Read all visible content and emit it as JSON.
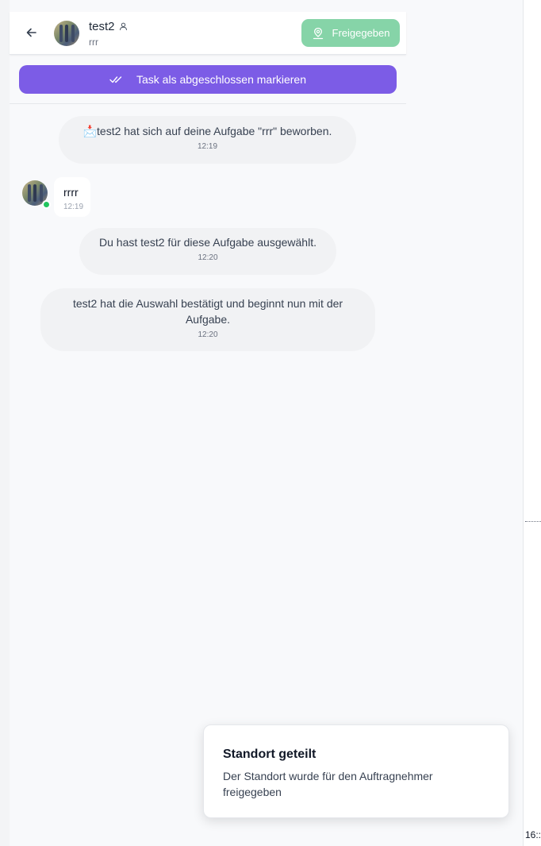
{
  "header": {
    "contact_name": "test2",
    "subtitle": "rrr",
    "share_button_label": "Freigegeben"
  },
  "action": {
    "complete_task_label": "Task als abgeschlossen markieren"
  },
  "messages": [
    {
      "type": "system",
      "emoji": "📩",
      "text": "test2 hat sich auf deine Aufgabe \"rrr\" beworben.",
      "time": "12:19"
    },
    {
      "type": "user",
      "sender": "test2",
      "text": "rrrr",
      "time": "12:19"
    },
    {
      "type": "system",
      "text": "Du hast test2 für diese Aufgabe ausgewählt.",
      "time": "12:20"
    },
    {
      "type": "system",
      "text": "test2 hat die Auswahl bestätigt und beginnt nun mit der Aufgabe.",
      "time": "12:20"
    }
  ],
  "toast": {
    "title": "Standort geteilt",
    "description": "Der Standort wurde für den Auftragnehmer freigegeben"
  },
  "edge": {
    "clipped_time": "16::"
  },
  "colors": {
    "accent_purple": "#7c5ce6",
    "share_green": "#86d4a8",
    "online_green": "#22c55e"
  },
  "icons": {
    "back": "arrow-left-icon",
    "user": "user-icon",
    "location": "map-pin-icon",
    "check": "double-check-icon"
  }
}
